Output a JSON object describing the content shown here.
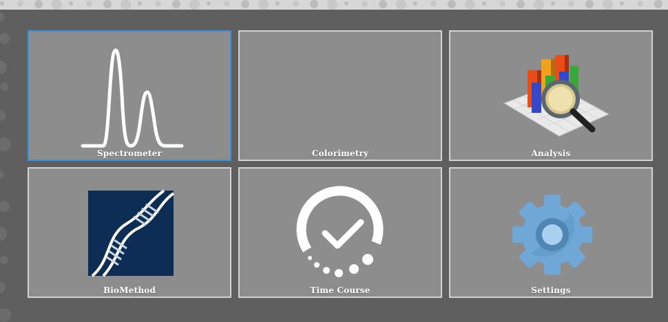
{
  "tiles": [
    {
      "label": "Spectrometer",
      "icon": "spectrum-peaks-icon",
      "selected": true
    },
    {
      "label": "Colorimetry",
      "icon": "color-spectrum-icon",
      "selected": false
    },
    {
      "label": "Analysis",
      "icon": "chart-magnifier-icon",
      "selected": false
    },
    {
      "label": "BioMethod",
      "icon": "dna-helix-icon",
      "selected": false
    },
    {
      "label": "Time Course",
      "icon": "timer-check-icon",
      "selected": false
    },
    {
      "label": "Settings",
      "icon": "gear-icon",
      "selected": false
    }
  ],
  "colors": {
    "background": "#5f5f5f",
    "tile": "#8d8d8d",
    "tile_border": "#d3d3d3",
    "selected_border": "#3f8fd8",
    "biomethod_bg": "#0d2d55"
  }
}
